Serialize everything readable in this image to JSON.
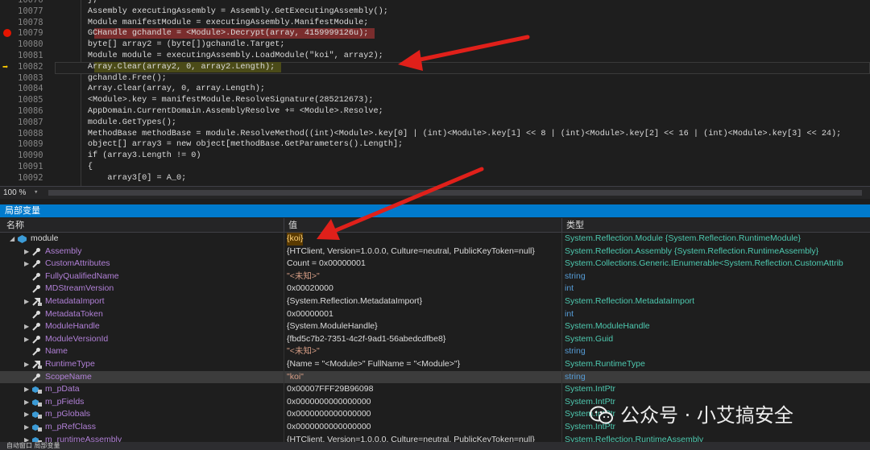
{
  "editor": {
    "lines": [
      {
        "num": "10076",
        "text": "        };",
        "mark": ""
      },
      {
        "num": "10077",
        "text": "        Assembly executingAssembly = Assembly.GetExecutingAssembly();",
        "mark": ""
      },
      {
        "num": "10078",
        "text": "        Module manifestModule = executingAssembly.ManifestModule;",
        "mark": ""
      },
      {
        "num": "10079",
        "text": "        GCHandle gchandle = <Module>.Decrypt(array, 4159999126u);",
        "mark": "breakpoint"
      },
      {
        "num": "10080",
        "text": "        byte[] array2 = (byte[])gchandle.Target;",
        "mark": ""
      },
      {
        "num": "10081",
        "text": "        Module module = executingAssembly.LoadModule(\"koi\", array2);",
        "mark": ""
      },
      {
        "num": "10082",
        "text": "        Array.Clear(array2, 0, array2.Length);",
        "mark": "current"
      },
      {
        "num": "10083",
        "text": "        gchandle.Free();",
        "mark": ""
      },
      {
        "num": "10084",
        "text": "        Array.Clear(array, 0, array.Length);",
        "mark": ""
      },
      {
        "num": "10085",
        "text": "        <Module>.key = manifestModule.ResolveSignature(285212673);",
        "mark": ""
      },
      {
        "num": "10086",
        "text": "        AppDomain.CurrentDomain.AssemblyResolve += <Module>.Resolve;",
        "mark": ""
      },
      {
        "num": "10087",
        "text": "        module.GetTypes();",
        "mark": ""
      },
      {
        "num": "10088",
        "text": "        MethodBase methodBase = module.ResolveMethod((int)<Module>.key[0] | (int)<Module>.key[1] << 8 | (int)<Module>.key[2] << 16 | (int)<Module>.key[3] << 24);",
        "mark": ""
      },
      {
        "num": "10089",
        "text": "        object[] array3 = new object[methodBase.GetParameters().Length];",
        "mark": ""
      },
      {
        "num": "10090",
        "text": "        if (array3.Length != 0)",
        "mark": ""
      },
      {
        "num": "10091",
        "text": "        {",
        "mark": ""
      },
      {
        "num": "10092",
        "text": "            array3[0] = A_0;",
        "mark": ""
      }
    ]
  },
  "statusbar": {
    "zoom": "100 %"
  },
  "locals": {
    "title": "局部变量",
    "headers": {
      "name": "名称",
      "value": "值",
      "type": "类型"
    },
    "rows": [
      {
        "name": "module",
        "value": "{koi}",
        "type": "System.Reflection.Module {System.Reflection.RuntimeModule}",
        "level": 0,
        "expanded": true,
        "icon": "object-icon",
        "name_color": "#dcdcdc",
        "value_color": "#dcdcdc"
      },
      {
        "name": "Assembly",
        "value": "{HTClient, Version=1.0.0.0, Culture=neutral, PublicKeyToken=null}",
        "type": "System.Reflection.Assembly {System.Reflection.RuntimeAssembly}",
        "level": 1,
        "expanded": false,
        "icon": "property-icon",
        "name_color": "#b180d7",
        "value_color": "#dcdcdc"
      },
      {
        "name": "CustomAttributes",
        "value": "Count = 0x00000001",
        "type": "System.Collections.Generic.IEnumerable<System.Reflection.CustomAttrib",
        "level": 1,
        "expanded": false,
        "icon": "property-icon",
        "name_color": "#b180d7",
        "value_color": "#dcdcdc"
      },
      {
        "name": "FullyQualifiedName",
        "value": "\"<未知>\"",
        "type": "string",
        "level": 1,
        "expanded": null,
        "icon": "property-icon",
        "name_color": "#b180d7",
        "value_color": "#d69d85"
      },
      {
        "name": "MDStreamVersion",
        "value": "0x00020000",
        "type": "int",
        "level": 1,
        "expanded": null,
        "icon": "property-icon",
        "name_color": "#b180d7",
        "value_color": "#dcdcdc"
      },
      {
        "name": "MetadataImport",
        "value": "{System.Reflection.MetadataImport}",
        "type": "System.Reflection.MetadataImport",
        "level": 1,
        "expanded": false,
        "icon": "private-property-icon",
        "name_color": "#b180d7",
        "value_color": "#dcdcdc"
      },
      {
        "name": "MetadataToken",
        "value": "0x00000001",
        "type": "int",
        "level": 1,
        "expanded": null,
        "icon": "property-icon",
        "name_color": "#b180d7",
        "value_color": "#dcdcdc"
      },
      {
        "name": "ModuleHandle",
        "value": "{System.ModuleHandle}",
        "type": "System.ModuleHandle",
        "level": 1,
        "expanded": false,
        "icon": "property-icon",
        "name_color": "#b180d7",
        "value_color": "#dcdcdc"
      },
      {
        "name": "ModuleVersionId",
        "value": "{fbd5c7b2-7351-4c2f-9ad1-56abedcdfbe8}",
        "type": "System.Guid",
        "level": 1,
        "expanded": false,
        "icon": "property-icon",
        "name_color": "#b180d7",
        "value_color": "#dcdcdc"
      },
      {
        "name": "Name",
        "value": "\"<未知>\"",
        "type": "string",
        "level": 1,
        "expanded": null,
        "icon": "property-icon",
        "name_color": "#b180d7",
        "value_color": "#d69d85"
      },
      {
        "name": "RuntimeType",
        "value": "{Name = \"<Module>\" FullName = \"<Module>\"}",
        "type": "System.RuntimeType",
        "level": 1,
        "expanded": false,
        "icon": "private-property-icon",
        "name_color": "#b180d7",
        "value_color": "#dcdcdc"
      },
      {
        "name": "ScopeName",
        "value": "\"koi\"",
        "type": "string",
        "level": 1,
        "expanded": null,
        "icon": "property-icon",
        "name_color": "#b180d7",
        "value_color": "#d69d85"
      },
      {
        "name": "m_pData",
        "value": "0x00007FFF29B96098",
        "type": "System.IntPtr",
        "level": 1,
        "expanded": false,
        "icon": "field-icon",
        "name_color": "#b180d7",
        "value_color": "#dcdcdc"
      },
      {
        "name": "m_pFields",
        "value": "0x0000000000000000",
        "type": "System.IntPtr",
        "level": 1,
        "expanded": false,
        "icon": "field-icon",
        "name_color": "#b180d7",
        "value_color": "#dcdcdc"
      },
      {
        "name": "m_pGlobals",
        "value": "0x0000000000000000",
        "type": "System.IntPtr",
        "level": 1,
        "expanded": false,
        "icon": "field-icon",
        "name_color": "#b180d7",
        "value_color": "#dcdcdc"
      },
      {
        "name": "m_pRefClass",
        "value": "0x0000000000000000",
        "type": "System.IntPtr",
        "level": 1,
        "expanded": false,
        "icon": "field-icon",
        "name_color": "#b180d7",
        "value_color": "#dcdcdc"
      },
      {
        "name": "m_runtimeAssembly",
        "value": "{HTClient, Version=1.0.0.0, Culture=neutral, PublicKeyToken=null}",
        "type": "System.Reflection.RuntimeAssembly",
        "level": 1,
        "expanded": false,
        "icon": "field-icon",
        "name_color": "#b180d7",
        "value_color": "#dcdcdc"
      }
    ]
  },
  "footer": {
    "tabs": "自动窗口  局部变量"
  },
  "watermark": {
    "text": "公众号 · 小艾搞安全"
  },
  "colors": {
    "accent": "#007acc",
    "breakpoint": "#e51400",
    "annotation_arrow": "#e0201a",
    "type_teal": "#4ec9b0",
    "member_purple": "#b180d7"
  }
}
